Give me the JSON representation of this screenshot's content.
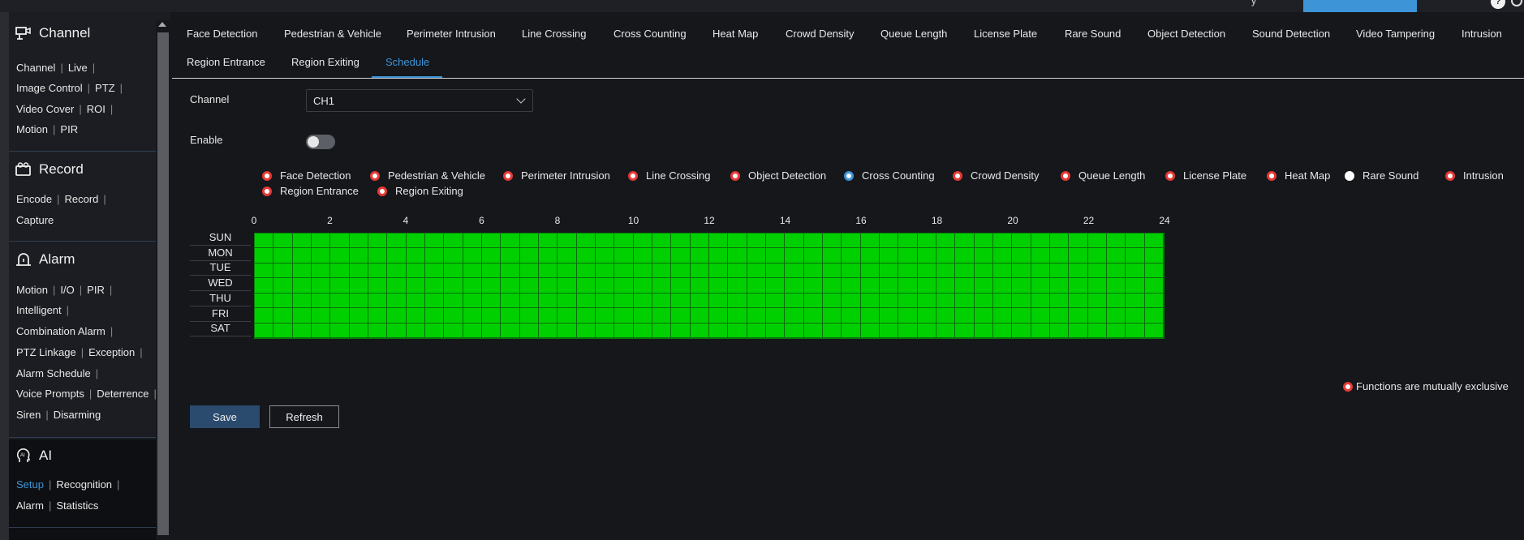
{
  "topbar": {
    "partial_text": "y",
    "help_icon": "?"
  },
  "sidebar": {
    "channel": {
      "title": "Channel",
      "icon": "camera-icon",
      "rows": [
        [
          "Channel",
          "Live"
        ],
        [
          "Image Control",
          "PTZ"
        ],
        [
          "Video Cover",
          "ROI"
        ],
        [
          "Motion",
          "PIR"
        ]
      ]
    },
    "record": {
      "title": "Record",
      "icon": "record-icon",
      "rows": [
        [
          "Encode",
          "Record"
        ],
        [
          "Capture"
        ]
      ]
    },
    "alarm": {
      "title": "Alarm",
      "icon": "alarm-icon",
      "rows": [
        [
          "Motion",
          "I/O",
          "PIR"
        ],
        [
          "Intelligent"
        ],
        [
          "Combination Alarm"
        ],
        [
          "PTZ Linkage",
          "Exception"
        ],
        [
          "Alarm Schedule"
        ],
        [
          "Voice Prompts",
          "Deterrence"
        ],
        [
          "Siren",
          "Disarming"
        ]
      ]
    },
    "ai": {
      "title": "AI",
      "icon": "ai-head-icon",
      "active_item": "Setup",
      "rows": [
        [
          "Setup",
          "Recognition"
        ],
        [
          "Alarm",
          "Statistics"
        ]
      ]
    }
  },
  "tabs": {
    "row1": [
      "Face Detection",
      "Pedestrian & Vehicle",
      "Perimeter Intrusion",
      "Line Crossing",
      "Cross Counting",
      "Heat Map",
      "Crowd Density",
      "Queue Length",
      "License Plate",
      "Rare Sound",
      "Object Detection",
      "Sound Detection",
      "Video Tampering",
      "Intrusion"
    ],
    "row2": [
      "Region Entrance",
      "Region Exiting",
      "Schedule"
    ],
    "active": "Schedule"
  },
  "form": {
    "channel_label": "Channel",
    "channel_value": "CH1",
    "enable_label": "Enable",
    "enable_on": false
  },
  "functions": {
    "items": [
      "Face Detection",
      "Pedestrian & Vehicle",
      "Perimeter Intrusion",
      "Line Crossing",
      "Object Detection",
      "Cross Counting",
      "Crowd Density",
      "Queue Length",
      "License Plate",
      "Heat Map",
      "Rare Sound",
      "Intrusion",
      "Region Entrance",
      "Region Exiting"
    ],
    "selected": "Cross Counting"
  },
  "schedule": {
    "hours": [
      "0",
      "2",
      "4",
      "6",
      "8",
      "10",
      "12",
      "14",
      "16",
      "18",
      "20",
      "22",
      "24"
    ],
    "days": [
      "SUN",
      "MON",
      "TUE",
      "WED",
      "THU",
      "FRI",
      "SAT"
    ],
    "fill_color": "#00d000",
    "all_enabled": true
  },
  "legend": {
    "mutex_text": "Functions are mutually exclusive"
  },
  "buttons": {
    "save": "Save",
    "refresh": "Refresh"
  },
  "colors": {
    "accent": "#3d94d6",
    "radio_ring": "#e53935",
    "grid": "#00d000"
  }
}
